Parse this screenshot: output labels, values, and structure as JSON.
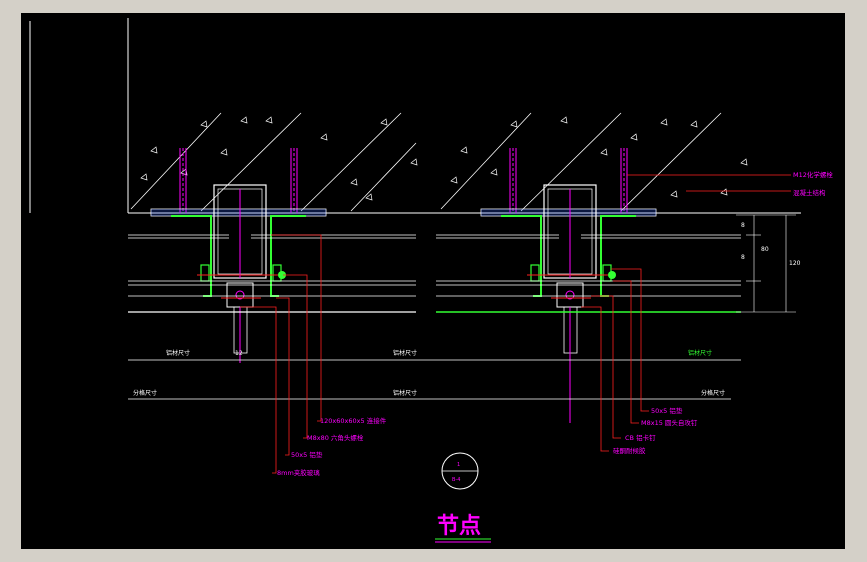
{
  "drawing": {
    "title": "节点",
    "detail_circle_top": "1",
    "detail_circle_bottom": "B-4",
    "colors": {
      "background": "#000000",
      "window": "#d4d0c8",
      "line": "#ffffff",
      "annotation": "#ff00ff",
      "steel": "#33ff33",
      "leader_red": "#ff2020",
      "seal_blue": "#3060ff"
    },
    "callouts_left": [
      "120x60x60x5 连接件",
      "M8x80 六角头螺栓",
      "50x5 铝垫",
      "8mm夹胶玻璃"
    ],
    "callouts_right": [
      "50x5 铝垫",
      "M8x15 圆头自攻钉",
      "CB 铝卡钉",
      "硅酮耐候胶"
    ],
    "callouts_top_right": [
      "M12化学螺栓",
      "混凝土结构"
    ],
    "dimension_labels": {
      "left_green_a": "铝材尺寸",
      "left_middle": "12",
      "center_a": "铝材尺寸",
      "right_green_a": "铝材尺寸",
      "bottom_left": "分格尺寸",
      "bottom_center": "铝材尺寸",
      "bottom_right": "分格尺寸"
    },
    "vertical_dims": [
      "8",
      "80",
      "8",
      "120"
    ]
  }
}
